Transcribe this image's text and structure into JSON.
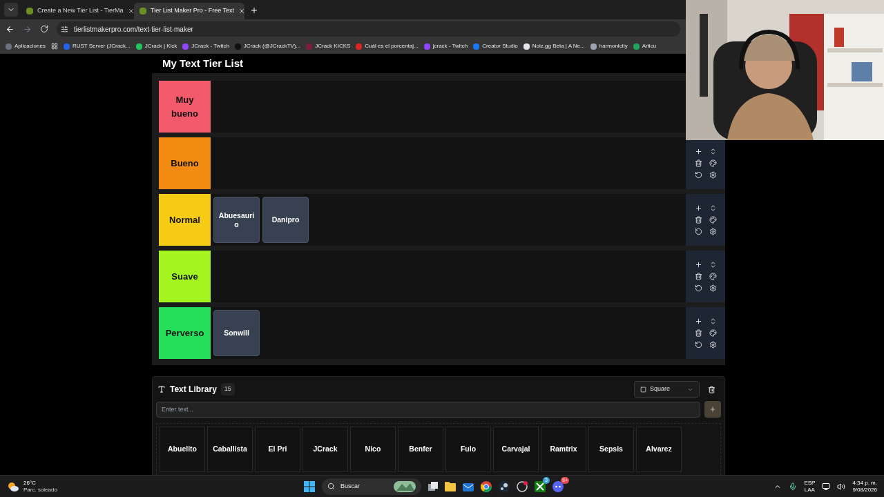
{
  "browser": {
    "tabs": [
      {
        "title": "Create a New Tier List - TierMa",
        "selected": false
      },
      {
        "title": "Tier List Maker Pro - Free Text",
        "selected": true
      }
    ],
    "url": "tierlistmakerpro.com/text-tier-list-maker",
    "bookmarks": [
      "Aplicaciones",
      "RUST Server (JCrack...",
      "JCrack | Kick",
      "JCrack - Twitch",
      "JCrack (@JCrackTV)...",
      "JCrack KICKS",
      "Cuál es el porcentaj...",
      "jcrack - Twitch",
      "Creator Studio",
      "Noiz.gg Beta | A Ne...",
      "harmonicity",
      "Articu"
    ]
  },
  "page": {
    "title": "My Text Tier List",
    "tiers": [
      {
        "label": "Muy bueno",
        "color": "#f25a6b"
      },
      {
        "label": "Bueno",
        "color": "#f28b12"
      },
      {
        "label": "Normal",
        "color": "#f5cb16",
        "items": [
          "Abuesaurio",
          "Danipro"
        ]
      },
      {
        "label": "Suave",
        "color": "#a5f520"
      },
      {
        "label": "Perverso",
        "color": "#26e05c",
        "items": [
          "Sonwill"
        ]
      }
    ],
    "library": {
      "title": "Text Library",
      "count": "15",
      "shape": "Square",
      "input": {
        "placeholder": "Enter text..."
      },
      "items": [
        "Abuelito",
        "Caballista",
        "El Pri",
        "JCrack",
        "Nico",
        "Benfer",
        "Fulo",
        "Carvajal",
        "Ramtrix",
        "Sepsis",
        "Alvarez"
      ]
    }
  },
  "taskbar": {
    "weather": {
      "temp": "26°C",
      "desc": "Parc. soleado"
    },
    "search": {
      "placeholder": "Buscar"
    },
    "xbox_badge": "3",
    "discord_badge": "9+",
    "language": [
      "ESP",
      "LAA"
    ],
    "time": "4:34 p. m.",
    "date": "9/08/2026"
  }
}
